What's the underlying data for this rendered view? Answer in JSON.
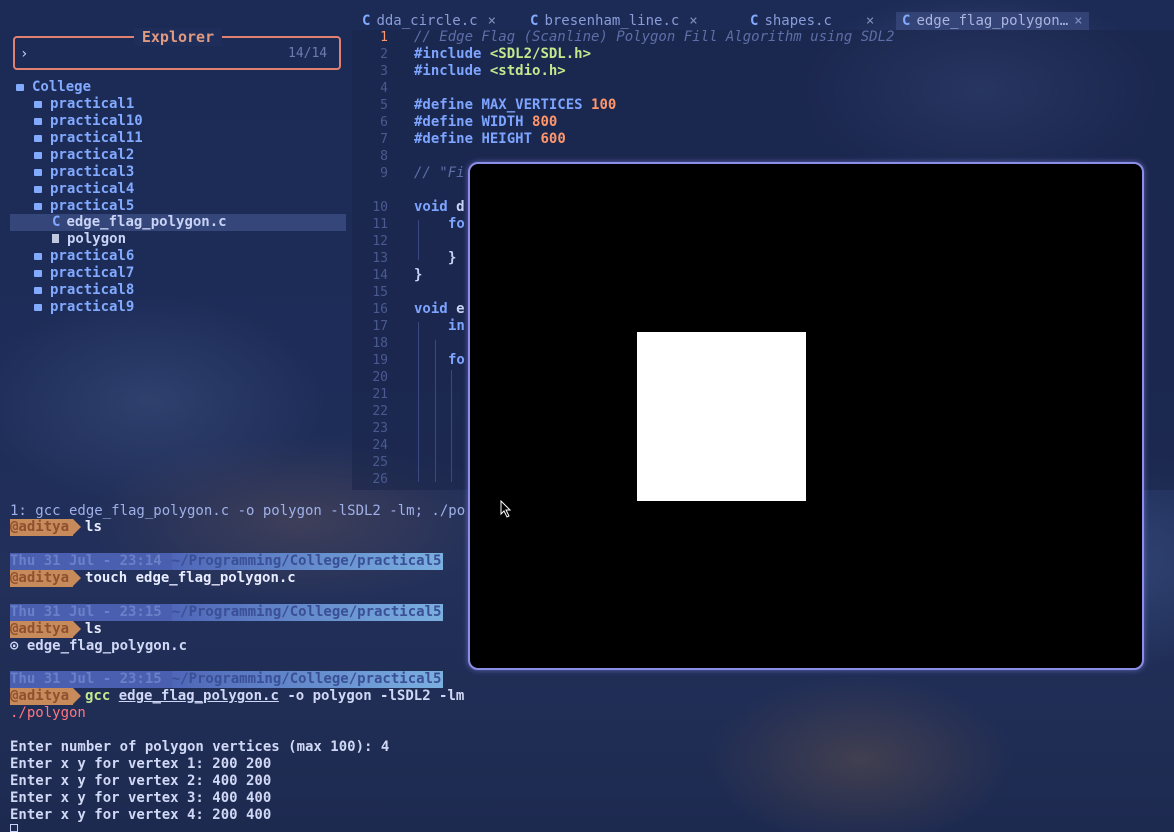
{
  "explorer": {
    "title": "Explorer",
    "prompt": "›",
    "count": "14/14",
    "root": "College",
    "items": [
      {
        "label": "practical1",
        "type": "folder"
      },
      {
        "label": "practical10",
        "type": "folder"
      },
      {
        "label": "practical11",
        "type": "folder"
      },
      {
        "label": "practical2",
        "type": "folder"
      },
      {
        "label": "practical3",
        "type": "folder"
      },
      {
        "label": "practical4",
        "type": "folder"
      },
      {
        "label": "practical5",
        "type": "folder"
      },
      {
        "label": "edge_flag_polygon.c",
        "type": "c-file"
      },
      {
        "label": "polygon",
        "type": "file"
      },
      {
        "label": "practical6",
        "type": "folder"
      },
      {
        "label": "practical7",
        "type": "folder"
      },
      {
        "label": "practical8",
        "type": "folder"
      },
      {
        "label": "practical9",
        "type": "folder"
      }
    ]
  },
  "tabs": [
    {
      "icon": "C",
      "label": "dda_circle.c",
      "close": "×"
    },
    {
      "icon": "C",
      "label": "bresenham_line.c",
      "close": "×"
    },
    {
      "icon": "C",
      "label": "shapes.c",
      "close": "×"
    },
    {
      "icon": "C",
      "label": "edge_flag_polygon…",
      "close": "×"
    }
  ],
  "editor": {
    "line_numbers": [
      "1",
      "2",
      "3",
      "4",
      "5",
      "6",
      "7",
      "8",
      "9",
      "10",
      "11",
      "12",
      "13",
      "14",
      "15",
      "16",
      "17",
      "18",
      "19",
      "20",
      "21",
      "22",
      "23",
      "24",
      "25",
      "26"
    ],
    "line1": "// Edge Flag (Scanline) Polygon Fill Algorithm using SDL2",
    "line2_kw": "#include",
    "line2_str": "<SDL2/SDL.h>",
    "line3_kw": "#include",
    "line3_str": "<stdio.h>",
    "line5_kw": "#define",
    "line5_name": "MAX_VERTICES",
    "line5_num": "100",
    "line6_kw": "#define",
    "line6_name": "WIDTH",
    "line6_num": "800",
    "line7_kw": "#define",
    "line7_name": "HEIGHT",
    "line7_num": "600",
    "line9": "// \"Fi",
    "line11_kw": "void",
    "line11_rest": "d",
    "line12": "fo",
    "line14": "}",
    "line16_kw": "void",
    "line16_rest": "e",
    "line17": "in",
    "line19": "fo"
  },
  "terminal": {
    "line1": "1: gcc edge_flag_polygon.c -o polygon -lSDL2 -lm; ./po",
    "user": "@aditya",
    "cmd1": "ls",
    "date1": "Thu 31 Jul - 23:14",
    "path1": "~/Programming/College/practical5",
    "cmd2": "touch edge_flag_polygon.c",
    "date2": "Thu 31 Jul - 23:15",
    "path2": "~/Programming/College/practical5",
    "cmd3": "ls",
    "ls_output": "⊙ edge_flag_polygon.c",
    "date3": "Thu 31 Jul - 23:15",
    "path3": "~/Programming/College/practical5",
    "cmd4_gcc": "gcc",
    "cmd4_file": "edge_flag_polygon.c",
    "cmd4_rest": "-o polygon -lSDL2 -lm",
    "cmd4_cont": "./polygon",
    "prompt1": "Enter number of polygon vertices (max 100): 4",
    "prompt2": "Enter x y for vertex 1: 200 200",
    "prompt3": "Enter x y for vertex 2: 400 200",
    "prompt4": "Enter x y for vertex 3: 400 400",
    "prompt5": "Enter x y for vertex 4: 200 400"
  },
  "colors": {
    "accent_orange": "#ff966c",
    "accent_blue": "#82aaff",
    "string_green": "#c3e88d",
    "sdl_border": "#8b8ee8"
  }
}
